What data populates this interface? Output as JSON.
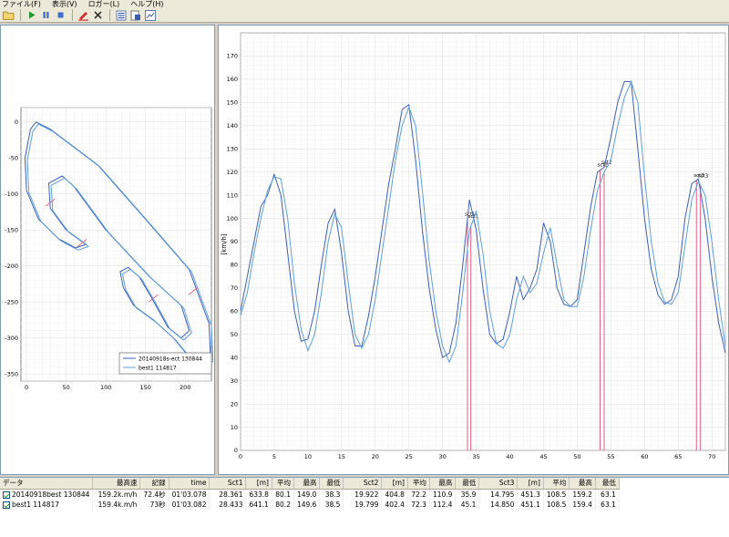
{
  "menu": [
    "ファイル(F)",
    "表示(V)",
    "ロガー(L)",
    "ヘルプ(H)"
  ],
  "toolbar": {
    "icons": [
      "open-folder-icon",
      "play-icon",
      "pause-icon",
      "stop-icon",
      "marker-icon",
      "delete-icon",
      "list-icon",
      "export-icon",
      "chart-icon"
    ]
  },
  "colors": {
    "series1": "#3b5fb8",
    "series2": "#5aa0e0",
    "marker": "#e0507a"
  },
  "map_chart": {
    "x_ticks": [
      "0",
      "50",
      "100",
      "150",
      "200"
    ],
    "y_ticks": [
      "0",
      "-50",
      "-100",
      "-150",
      "-200",
      "-250",
      "-300",
      "-350"
    ],
    "legend": [
      "20140918s-ect 130844",
      "best1 114817"
    ]
  },
  "chart_data": {
    "type": "line",
    "ylabel": "[km/h]",
    "xlim": [
      0,
      72
    ],
    "ylim": [
      0,
      180
    ],
    "x_ticks": [
      0,
      5,
      10,
      15,
      20,
      25,
      30,
      35,
      40,
      45,
      50,
      55,
      60,
      65,
      70
    ],
    "y_ticks": [
      0,
      10,
      20,
      30,
      40,
      50,
      60,
      70,
      80,
      90,
      100,
      110,
      120,
      130,
      140,
      150,
      160,
      170
    ],
    "series": [
      {
        "x": [
          0,
          1,
          2,
          3,
          4,
          5,
          6,
          7,
          8,
          9,
          10,
          11,
          12,
          13,
          14,
          15,
          16,
          17,
          18,
          19,
          20,
          21,
          22,
          23,
          24,
          25,
          26,
          27,
          28,
          29,
          30,
          31,
          32,
          33,
          34,
          35,
          36,
          37,
          38,
          39,
          40,
          41,
          42,
          43,
          44,
          45,
          46,
          47,
          48,
          49,
          50,
          51,
          52,
          53,
          54,
          55,
          56,
          57,
          58,
          59,
          60,
          61,
          62,
          63,
          64,
          65,
          66,
          67,
          68,
          69,
          70,
          71,
          72
        ],
        "y": [
          60,
          75,
          90,
          105,
          110,
          119,
          110,
          85,
          60,
          47,
          48,
          60,
          80,
          98,
          104,
          85,
          60,
          45,
          45,
          58,
          75,
          95,
          115,
          130,
          147,
          149,
          125,
          95,
          70,
          52,
          40,
          42,
          55,
          80,
          108,
          95,
          70,
          50,
          46,
          48,
          60,
          75,
          65,
          70,
          78,
          98,
          90,
          70,
          63,
          62,
          65,
          85,
          105,
          120,
          122,
          135,
          150,
          159,
          159,
          130,
          100,
          78,
          67,
          63,
          65,
          75,
          100,
          115,
          117,
          100,
          75,
          55,
          42
        ]
      },
      {
        "x": [
          0,
          1,
          2,
          3,
          4,
          5,
          6,
          7,
          8,
          9,
          10,
          11,
          12,
          13,
          14,
          15,
          16,
          17,
          18,
          19,
          20,
          21,
          22,
          23,
          24,
          25,
          26,
          27,
          28,
          29,
          30,
          31,
          32,
          33,
          34,
          35,
          36,
          37,
          38,
          39,
          40,
          41,
          42,
          43,
          44,
          45,
          46,
          47,
          48,
          49,
          50,
          51,
          52,
          53,
          54,
          55,
          56,
          57,
          58,
          59,
          60,
          61,
          62,
          63,
          64,
          65,
          66,
          67,
          68,
          69,
          70,
          71,
          72
        ],
        "y": [
          58,
          68,
          85,
          100,
          112,
          118,
          117,
          100,
          72,
          52,
          43,
          50,
          68,
          90,
          102,
          96,
          72,
          50,
          44,
          50,
          65,
          85,
          105,
          125,
          140,
          148,
          140,
          112,
          82,
          60,
          45,
          38,
          45,
          68,
          95,
          103,
          85,
          60,
          46,
          44,
          50,
          65,
          75,
          68,
          72,
          85,
          96,
          80,
          65,
          62,
          62,
          75,
          95,
          112,
          120,
          125,
          140,
          152,
          159,
          150,
          118,
          90,
          72,
          64,
          63,
          68,
          88,
          108,
          116,
          110,
          90,
          65,
          45
        ]
      }
    ],
    "markers": [
      {
        "x": 33.7,
        "label": "sct1"
      },
      {
        "x": 34.2,
        "label": "sct1"
      },
      {
        "x": 53.4,
        "label": "sct2"
      },
      {
        "x": 54.0,
        "label": "sct2"
      },
      {
        "x": 67.7,
        "label": "sct3"
      },
      {
        "x": 68.3,
        "label": "sct3"
      }
    ]
  },
  "table": {
    "headers": [
      "データ",
      "最高速",
      "記録",
      "time",
      "Sct1",
      "[m]",
      "平均",
      "最高",
      "最低",
      "Sct2",
      "[m]",
      "平均",
      "最高",
      "最低",
      "Sct3",
      "[m]",
      "平均",
      "最高",
      "最低"
    ],
    "rows": [
      [
        "20140918best 130844",
        "159.2k.m/h",
        "72.4秒",
        "01'03.078",
        "28.361",
        "633.8",
        "80.1",
        "149.0",
        "38.3",
        "19.922",
        "404.8",
        "72.2",
        "110.9",
        "35.9",
        "14.795",
        "451.3",
        "108.5",
        "159.2",
        "63.1"
      ],
      [
        "best1 114817",
        "159.4k.m/h",
        "73秒",
        "01'03.082",
        "28.433",
        "641.1",
        "80.2",
        "149.6",
        "38.5",
        "19.799",
        "402.4",
        "72.3",
        "112.4",
        "45.1",
        "14.850",
        "451.1",
        "108.5",
        "159.4",
        "63.1"
      ]
    ]
  }
}
